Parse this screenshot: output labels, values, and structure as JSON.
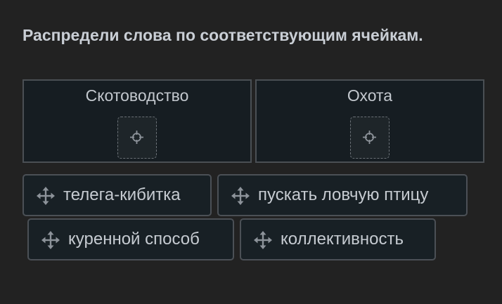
{
  "task": {
    "instruction": "Распредели слова по соответствующим ячейкам."
  },
  "cells": [
    {
      "label": "Скотоводство",
      "slot_icon": "move-target-icon"
    },
    {
      "label": "Охота",
      "slot_icon": "move-target-icon"
    }
  ],
  "chips": [
    {
      "label": "телега-кибитка",
      "icon": "drag-move-icon"
    },
    {
      "label": "пускать ловчую птицу",
      "icon": "drag-move-icon"
    },
    {
      "label": "куренной способ",
      "icon": "drag-move-icon"
    },
    {
      "label": "коллективность",
      "icon": "drag-move-icon"
    }
  ],
  "colors": {
    "background": "#222222",
    "cell_background": "#161d22",
    "border": "#4a4f54",
    "text": "#c6cbd1"
  }
}
